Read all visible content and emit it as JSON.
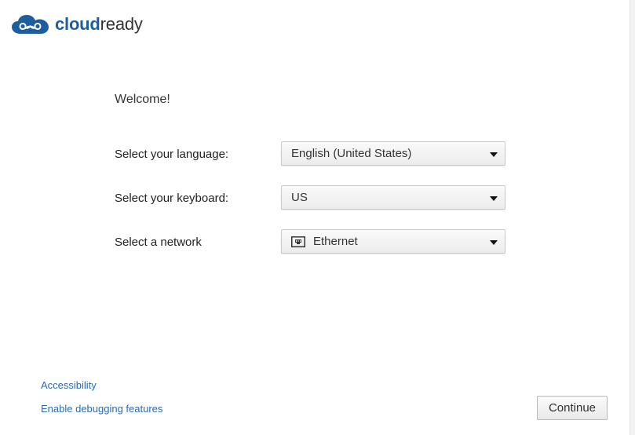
{
  "logo": {
    "text_strong": "cloud",
    "text_light": "ready",
    "icon": "cloud-infinity-icon",
    "color": "#1f5e9e"
  },
  "welcome": "Welcome!",
  "form": {
    "language": {
      "label": "Select your language:",
      "value": "English (United States)"
    },
    "keyboard": {
      "label": "Select your keyboard:",
      "value": "US"
    },
    "network": {
      "label": "Select a network",
      "value": "Ethernet",
      "icon": "ethernet-icon"
    }
  },
  "links": {
    "accessibility": "Accessibility",
    "debugging": "Enable debugging features"
  },
  "continue_label": "Continue",
  "colors": {
    "link": "#2a6bb4"
  }
}
